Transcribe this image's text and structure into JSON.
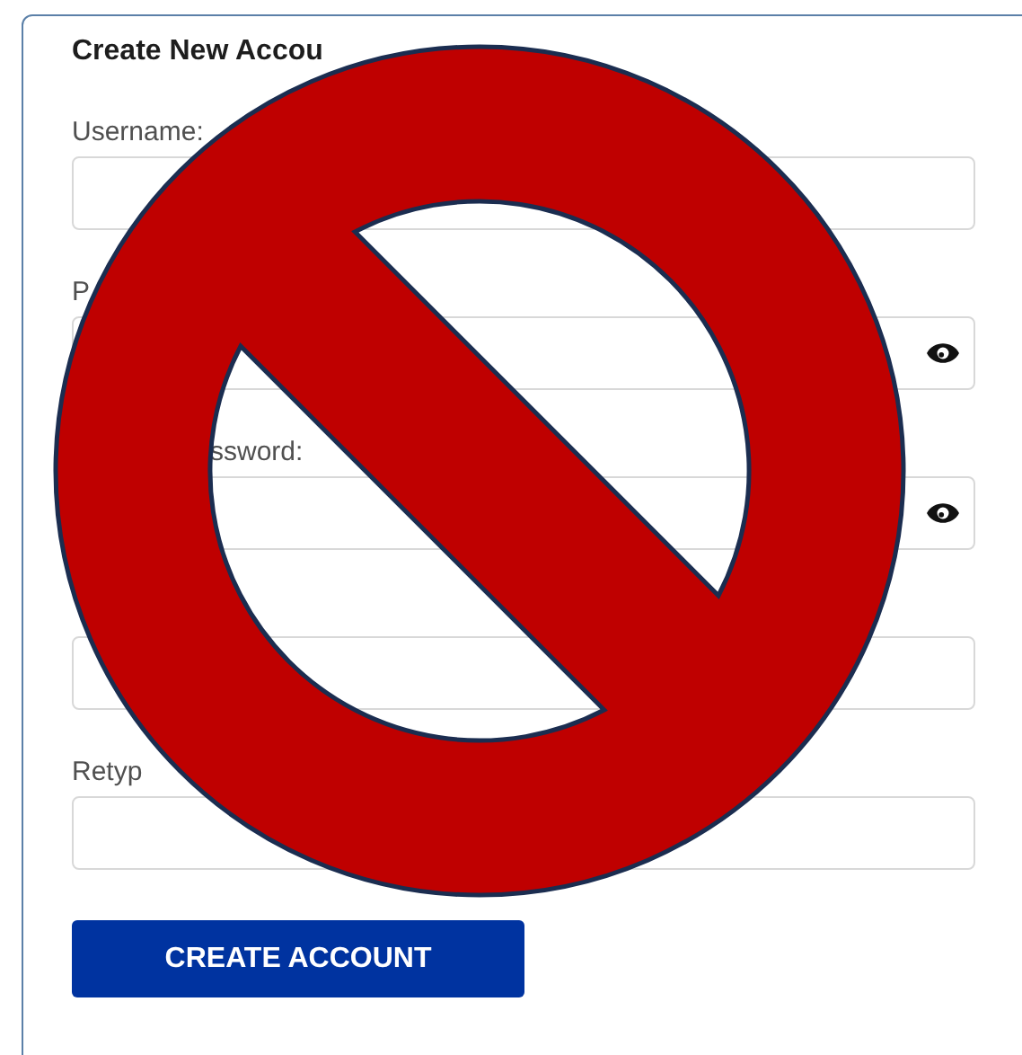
{
  "form": {
    "title": "Create New Accou",
    "fields": [
      {
        "label": "Username:",
        "kind": "text"
      },
      {
        "label": "P",
        "kind": "password"
      },
      {
        "label": "ssword:",
        "kind": "password"
      },
      {
        "kind": "text"
      },
      {
        "label": "Retyp",
        "kind": "text"
      }
    ],
    "submit_button": "CREATE ACCOUNT"
  }
}
